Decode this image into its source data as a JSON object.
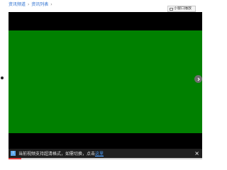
{
  "breadcrumb": {
    "item1": "资讯频道",
    "item2": "资讯列表",
    "separator": "›"
  },
  "mini_window": {
    "label": "小窗口播放"
  },
  "notice": {
    "text": "当前视频支持超清格式，如需切换，点击",
    "link": "这里",
    "close": "×"
  },
  "colors": {
    "video_area": "#008000",
    "player_bg": "#000000",
    "link": "#2a6fd0"
  },
  "icons": [
    "info-icon",
    "next-arrow-icon",
    "close-icon",
    "mini-window-icon"
  ]
}
